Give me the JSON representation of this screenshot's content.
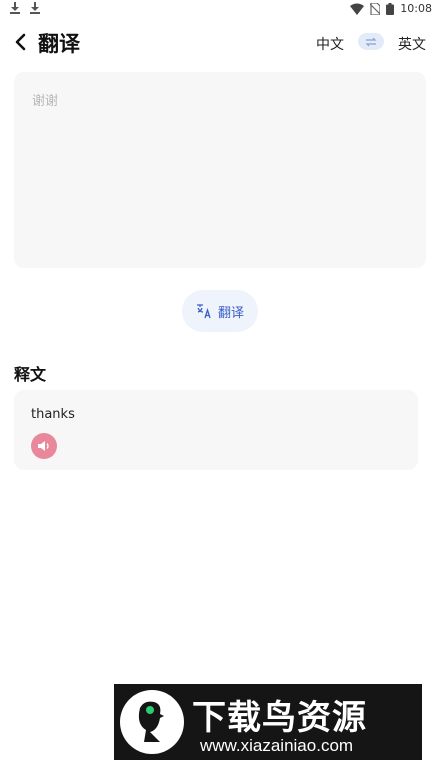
{
  "status_bar": {
    "time": "10:08",
    "left_icons": [
      "download-icon",
      "download-icon"
    ],
    "right_icons": [
      "wifi-icon",
      "no-sim-icon",
      "battery-icon"
    ]
  },
  "header": {
    "title": "翻译",
    "source_lang": "中文",
    "target_lang": "英文"
  },
  "input": {
    "placeholder": "谢谢",
    "value": ""
  },
  "translate_button": {
    "label": "翻译"
  },
  "result": {
    "section_title": "释文",
    "text": "thanks"
  },
  "watermark": {
    "title": "下载鸟资源",
    "url": "www.xiazainiao.com"
  },
  "colors": {
    "accent_blue": "#3b5fc4",
    "swap_bg": "#e3ebf9",
    "speaker_pink": "#e9889a",
    "card_bg": "#f7f7f7"
  }
}
